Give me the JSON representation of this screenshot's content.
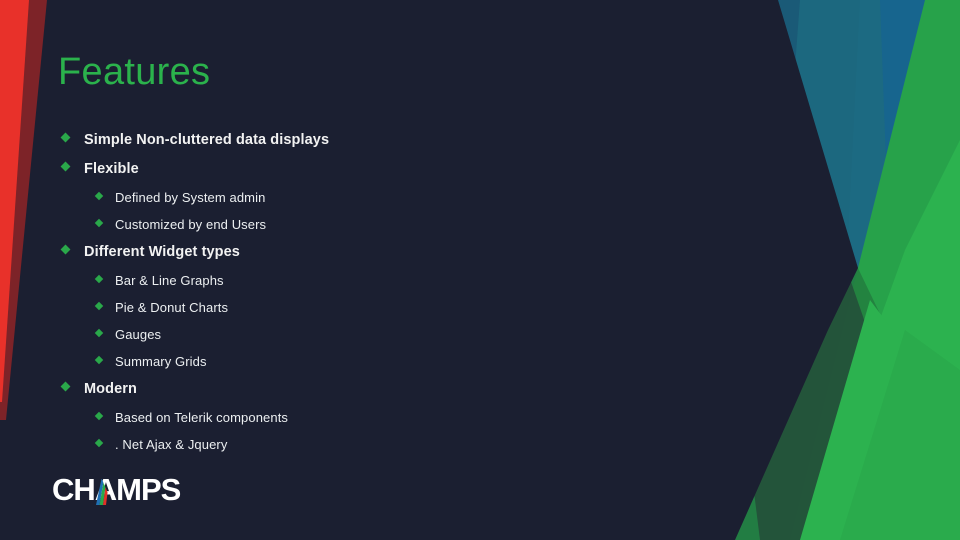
{
  "slide": {
    "title": "Features",
    "background_color": "#1b1f31",
    "title_color": "#2bb24c",
    "bullet_color": "#2aa84a",
    "text_color": "#f2f2f2"
  },
  "bullets": [
    {
      "level": 1,
      "text": "Simple Non-cluttered data displays"
    },
    {
      "level": 1,
      "text": "Flexible"
    },
    {
      "level": 2,
      "text": "Defined by System admin"
    },
    {
      "level": 2,
      "text": "Customized by end Users"
    },
    {
      "level": 1,
      "text": "Different Widget types"
    },
    {
      "level": 2,
      "text": "Bar & Line Graphs"
    },
    {
      "level": 2,
      "text": "Pie & Donut Charts"
    },
    {
      "level": 2,
      "text": "Gauges"
    },
    {
      "level": 2,
      "text": "Summary Grids"
    },
    {
      "level": 1,
      "text": "Modern"
    },
    {
      "level": 2,
      "text": "Based on Telerik components"
    },
    {
      "level": 2,
      "text": ". Net Ajax & Jquery"
    }
  ],
  "logo": {
    "wordmark": "CHAMPS",
    "wordmark_color": "#ffffff",
    "accent_colors": [
      "#1f6fb4",
      "#2aa84a",
      "#e03127"
    ]
  },
  "decor": {
    "left_stripe_bright_red": "#e8312a",
    "left_stripe_dark_red": "#7d2328",
    "right_navy": "#1b1f31",
    "right_blue_dark": "#1a5a77",
    "right_blue": "#17658e",
    "right_blue_teal": "#1d6b80",
    "right_green_dark": "#23503a",
    "right_green_mid": "#23803f",
    "right_green": "#27a24a",
    "right_green_bright": "#2cb24f"
  }
}
